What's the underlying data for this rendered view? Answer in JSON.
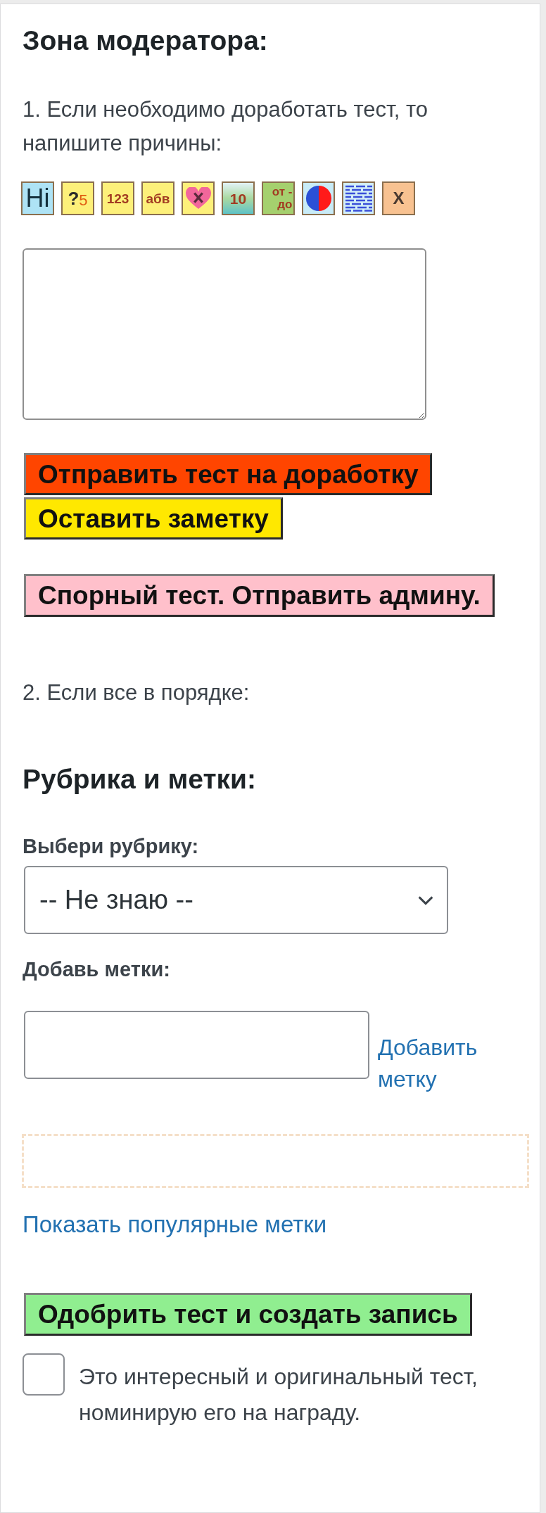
{
  "title": "Зона модератора:",
  "rework_instruction": "1. Если необходимо доработать тест, то напишите причины:",
  "format_tools": [
    {
      "kind": "large",
      "label": "Hi",
      "color": "#aee3f5"
    },
    {
      "kind": "question",
      "label": "?5",
      "color": "#fdf07a"
    },
    {
      "kind": "brown",
      "label": "123",
      "color": "#fdf07a"
    },
    {
      "kind": "brown",
      "label": "абв",
      "color": "#fdf07a"
    },
    {
      "kind": "heart",
      "color": "#fdf07a"
    },
    {
      "kind": "picture",
      "label": "10"
    },
    {
      "kind": "range",
      "label": "от - до",
      "color": "#a5d06e"
    },
    {
      "kind": "circle",
      "color": "#c8ebf7"
    },
    {
      "kind": "lines",
      "color": "#d2eef8"
    },
    {
      "kind": "dark",
      "label": "X",
      "color": "#f8c291"
    }
  ],
  "rework_buttons": [
    {
      "label": "Отправить тест на доработку",
      "color": "#ff4500"
    },
    {
      "label": "Оставить заметку",
      "color": "#ffe800"
    }
  ],
  "dispute_button": {
    "label": "Спорный тест. Отправить админу."
  },
  "approve_instruction": "2. Если все в порядке:",
  "category_section": {
    "heading": "Рубрика и метки:",
    "category_label": "Выбери рубрику:",
    "category_value": "-- Не знаю --",
    "tags_label": "Добавь метки:",
    "add_tag_link": "Добавить метку",
    "popular_tags_link": "Показать популярные метки"
  },
  "approve_button": {
    "label": "Одобрить тест и создать запись"
  },
  "nominate": {
    "checked": false,
    "label": "Это интересный и оригинальный тест, номинирую его на награду."
  }
}
